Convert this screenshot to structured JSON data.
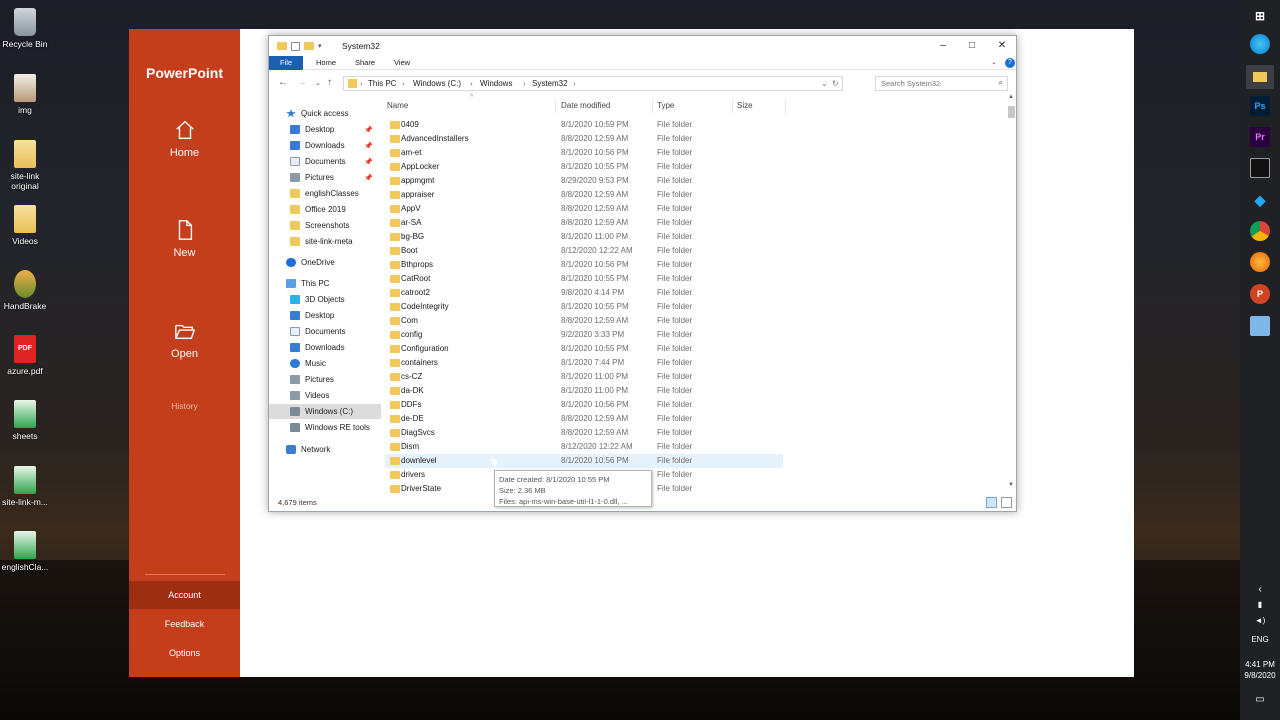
{
  "desktop": {
    "icons": [
      {
        "label": "Recycle Bin",
        "icon": "recycle-bin-icon"
      },
      {
        "label": "img",
        "icon": "image-file-icon"
      },
      {
        "label": "site-link original",
        "icon": "folder-icon"
      },
      {
        "label": "Videos",
        "icon": "folder-icon"
      },
      {
        "label": "HandBrake",
        "icon": "handbrake-icon"
      },
      {
        "label": "azure.pdf",
        "icon": "pdf-icon"
      },
      {
        "label": "sheets",
        "icon": "sheets-file-icon"
      },
      {
        "label": "site-link-m...",
        "icon": "sheets-file-icon"
      },
      {
        "label": "englishCla...",
        "icon": "sheets-file-icon"
      }
    ]
  },
  "taskbar": {
    "apps": [
      "windows-start-icon",
      "edge-icon",
      "file-explorer-icon",
      "photoshop-icon",
      "premiere-icon",
      "terminal-icon",
      "vscode-icon",
      "chrome-icon",
      "firefox-icon",
      "powerpoint-icon",
      "snip-icon"
    ],
    "photoshop_label": "Ps",
    "premiere_label": "Pr",
    "language": "ENG",
    "time": "4:41 PM",
    "date": "9/8/2020"
  },
  "powerpoint": {
    "title": "PowerPoint",
    "nav": [
      {
        "label": "Home",
        "icon": "home-icon"
      },
      {
        "label": "New",
        "icon": "new-file-icon"
      },
      {
        "label": "Open",
        "icon": "open-folder-icon"
      }
    ],
    "history": "History",
    "account": "Account",
    "feedback": "Feedback",
    "options": "Options",
    "accent": "#c43e1c"
  },
  "explorer": {
    "title": "System32",
    "ribbon_tabs": [
      "File",
      "Home",
      "Share",
      "View"
    ],
    "breadcrumb": [
      "This PC",
      "Windows (C:)",
      "Windows",
      "System32"
    ],
    "search_placeholder": "Search System32",
    "nav": {
      "quick_access": "Quick access",
      "quick_items": [
        {
          "label": "Desktop",
          "icon": "desktop-icon",
          "pinned": true
        },
        {
          "label": "Downloads",
          "icon": "downloads-icon",
          "pinned": true
        },
        {
          "label": "Documents",
          "icon": "documents-icon",
          "pinned": true
        },
        {
          "label": "Pictures",
          "icon": "pictures-icon",
          "pinned": true
        },
        {
          "label": "englishClasses",
          "icon": "folder-icon",
          "pinned": false
        },
        {
          "label": "Office 2019",
          "icon": "folder-icon",
          "pinned": false
        },
        {
          "label": "Screenshots",
          "icon": "folder-icon",
          "pinned": false
        },
        {
          "label": "site-link-meta",
          "icon": "folder-icon",
          "pinned": false
        }
      ],
      "onedrive": "OneDrive",
      "this_pc": "This PC",
      "pc_items": [
        {
          "label": "3D Objects",
          "icon": "3d-objects-icon"
        },
        {
          "label": "Desktop",
          "icon": "desktop-icon"
        },
        {
          "label": "Documents",
          "icon": "documents-icon"
        },
        {
          "label": "Downloads",
          "icon": "downloads-icon"
        },
        {
          "label": "Music",
          "icon": "music-icon"
        },
        {
          "label": "Pictures",
          "icon": "pictures-icon"
        },
        {
          "label": "Videos",
          "icon": "videos-icon"
        },
        {
          "label": "Windows (C:)",
          "icon": "drive-icon",
          "selected": true
        },
        {
          "label": "Windows RE tools",
          "icon": "drive-icon"
        }
      ],
      "network": "Network"
    },
    "columns": [
      "Name",
      "Date modified",
      "Type",
      "Size"
    ],
    "rows": [
      {
        "name": "0409",
        "date": "8/1/2020 10:59 PM",
        "type": "File folder"
      },
      {
        "name": "AdvancedInstallers",
        "date": "8/8/2020 12:59 AM",
        "type": "File folder"
      },
      {
        "name": "am-et",
        "date": "8/1/2020 10:56 PM",
        "type": "File folder"
      },
      {
        "name": "AppLocker",
        "date": "8/1/2020 10:55 PM",
        "type": "File folder"
      },
      {
        "name": "appmgmt",
        "date": "8/29/2020 9:53 PM",
        "type": "File folder"
      },
      {
        "name": "appraiser",
        "date": "8/8/2020 12:59 AM",
        "type": "File folder"
      },
      {
        "name": "AppV",
        "date": "8/8/2020 12:59 AM",
        "type": "File folder"
      },
      {
        "name": "ar-SA",
        "date": "8/8/2020 12:59 AM",
        "type": "File folder"
      },
      {
        "name": "bg-BG",
        "date": "8/1/2020 11:00 PM",
        "type": "File folder"
      },
      {
        "name": "Boot",
        "date": "8/12/2020 12:22 AM",
        "type": "File folder"
      },
      {
        "name": "Bthprops",
        "date": "8/1/2020 10:56 PM",
        "type": "File folder"
      },
      {
        "name": "CatRoot",
        "date": "8/1/2020 10:55 PM",
        "type": "File folder"
      },
      {
        "name": "catroot2",
        "date": "9/8/2020 4:14 PM",
        "type": "File folder"
      },
      {
        "name": "CodeIntegrity",
        "date": "8/1/2020 10:55 PM",
        "type": "File folder"
      },
      {
        "name": "Com",
        "date": "8/8/2020 12:59 AM",
        "type": "File folder"
      },
      {
        "name": "config",
        "date": "9/2/2020 3:33 PM",
        "type": "File folder"
      },
      {
        "name": "Configuration",
        "date": "8/1/2020 10:55 PM",
        "type": "File folder"
      },
      {
        "name": "containers",
        "date": "8/1/2020 7:44 PM",
        "type": "File folder"
      },
      {
        "name": "cs-CZ",
        "date": "8/1/2020 11:00 PM",
        "type": "File folder"
      },
      {
        "name": "da-DK",
        "date": "8/1/2020 11:00 PM",
        "type": "File folder"
      },
      {
        "name": "DDFs",
        "date": "8/1/2020 10:56 PM",
        "type": "File folder"
      },
      {
        "name": "de-DE",
        "date": "8/8/2020 12:59 AM",
        "type": "File folder"
      },
      {
        "name": "DiagSvcs",
        "date": "8/8/2020 12:59 AM",
        "type": "File folder"
      },
      {
        "name": "Dism",
        "date": "8/12/2020 12:22 AM",
        "type": "File folder"
      },
      {
        "name": "downlevel",
        "date": "8/1/2020 10:56 PM",
        "type": "File folder",
        "hover": true
      },
      {
        "name": "drivers",
        "date": "",
        "type": "File folder"
      },
      {
        "name": "DriverState",
        "date": "",
        "type": "File folder"
      }
    ],
    "status": "4,679 items",
    "tooltip": {
      "created": "Date created: 8/1/2020 10:55 PM",
      "size": "Size: 2.36 MB",
      "files": "Files: api-ms-win-base-util-l1-1-0.dll, ..."
    }
  }
}
